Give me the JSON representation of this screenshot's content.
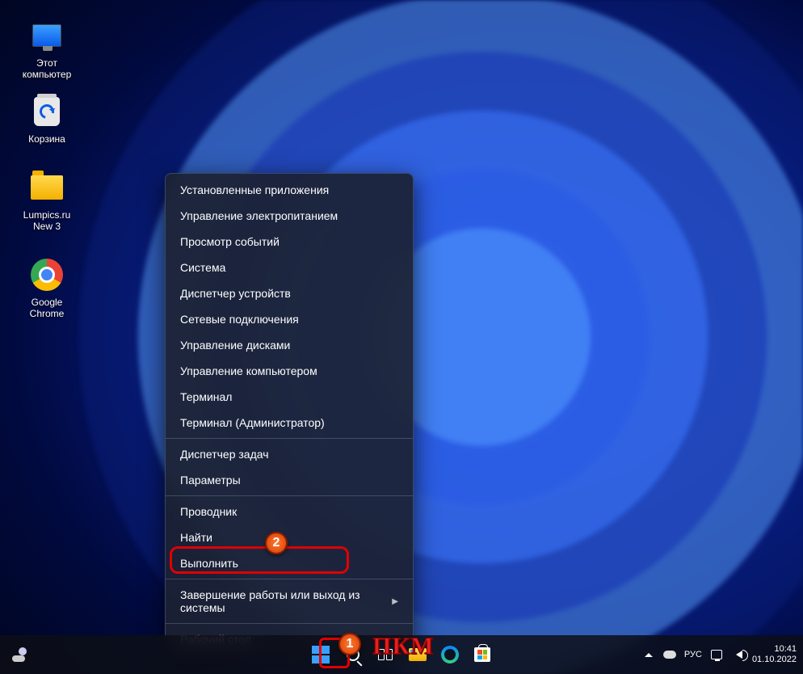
{
  "desktop_icons": [
    {
      "name": "this-pc",
      "label": "Этот\nкомпьютер"
    },
    {
      "name": "recycle-bin",
      "label": "Корзина"
    },
    {
      "name": "lumpics-folder",
      "label": "Lumpics.ru\nNew 3"
    },
    {
      "name": "google-chrome",
      "label": "Google\nChrome"
    }
  ],
  "context_menu": {
    "groups": [
      [
        "Установленные приложения",
        "Управление электропитанием",
        "Просмотр событий",
        "Система",
        "Диспетчер устройств",
        "Сетевые подключения",
        "Управление дисками",
        "Управление компьютером",
        "Терминал",
        "Терминал (Администратор)"
      ],
      [
        "Диспетчер задач",
        "Параметры"
      ],
      [
        "Проводник",
        "Найти",
        "Выполнить"
      ],
      [
        "Завершение работы или выход из системы"
      ],
      [
        "Рабочий стол"
      ]
    ],
    "submenu_item": "Завершение работы или выход из системы",
    "highlighted_item": "Выполнить"
  },
  "taskbar": {
    "center_items": [
      "start",
      "search",
      "task-view",
      "file-explorer",
      "edge",
      "microsoft-store"
    ],
    "language": "РУС",
    "time": "10:41",
    "date": "01.10.2022"
  },
  "annotations": {
    "callout1": "1",
    "callout2": "2",
    "rmb_label": "ПКМ"
  }
}
